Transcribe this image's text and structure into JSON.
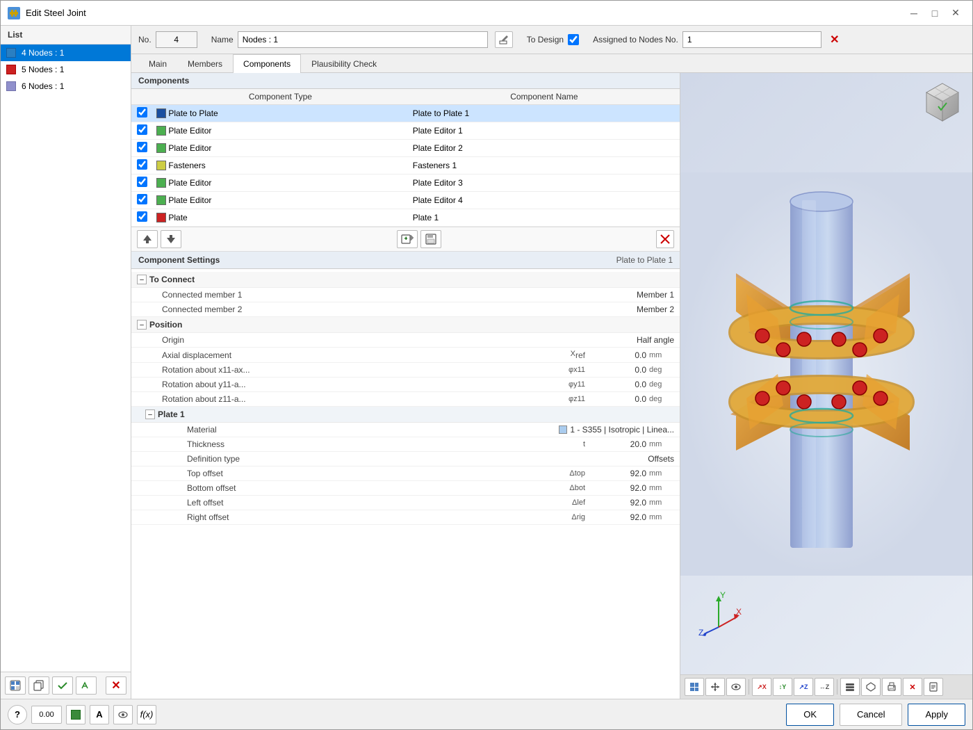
{
  "window": {
    "title": "Edit Steel Joint",
    "icon": "🔩"
  },
  "list": {
    "header": "List",
    "items": [
      {
        "id": 1,
        "label": "4  Nodes : 1",
        "color": "#2a7fc2",
        "selected": true
      },
      {
        "id": 2,
        "label": "5  Nodes : 1",
        "color": "#cc2222",
        "selected": false
      },
      {
        "id": 3,
        "label": "6  Nodes : 1",
        "color": "#9090cc",
        "selected": false
      }
    ]
  },
  "form": {
    "no_label": "No.",
    "no_value": "4",
    "name_label": "Name",
    "name_value": "Nodes : 1",
    "to_design_label": "To Design",
    "assigned_label": "Assigned to Nodes No.",
    "assigned_value": "1"
  },
  "tabs": [
    {
      "id": "main",
      "label": "Main",
      "active": false
    },
    {
      "id": "members",
      "label": "Members",
      "active": false
    },
    {
      "id": "components",
      "label": "Components",
      "active": true
    },
    {
      "id": "plausibility",
      "label": "Plausibility Check",
      "active": false
    }
  ],
  "components_section": {
    "header": "Components",
    "table_headers": [
      "",
      "Component Type",
      "Component Name"
    ],
    "rows": [
      {
        "checked": true,
        "color": "#1a4fa0",
        "type": "Plate to Plate",
        "name": "Plate to Plate 1",
        "selected": true
      },
      {
        "checked": true,
        "color": "#4caf50",
        "type": "Plate Editor",
        "name": "Plate Editor 1",
        "selected": false
      },
      {
        "checked": true,
        "color": "#4caf50",
        "type": "Plate Editor",
        "name": "Plate Editor 2",
        "selected": false
      },
      {
        "checked": true,
        "color": "#cdcd44",
        "type": "Fasteners",
        "name": "Fasteners 1",
        "selected": false
      },
      {
        "checked": true,
        "color": "#4caf50",
        "type": "Plate Editor",
        "name": "Plate Editor 3",
        "selected": false
      },
      {
        "checked": true,
        "color": "#4caf50",
        "type": "Plate Editor",
        "name": "Plate Editor 4",
        "selected": false
      },
      {
        "checked": true,
        "color": "#cc2222",
        "type": "Plate",
        "name": "Plate 1",
        "selected": false
      }
    ]
  },
  "comp_settings": {
    "header_title": "Component Settings",
    "header_name": "Plate to Plate 1",
    "groups": [
      {
        "id": "to_connect",
        "label": "To Connect",
        "collapsed": false,
        "rows": [
          {
            "label": "Connected member 1",
            "param": "",
            "value": "Member 1",
            "unit": "",
            "is_text": true
          },
          {
            "label": "Connected member 2",
            "param": "",
            "value": "Member 2",
            "unit": "",
            "is_text": true
          }
        ]
      },
      {
        "id": "position",
        "label": "Position",
        "collapsed": false,
        "rows": [
          {
            "label": "Origin",
            "param": "",
            "value": "Half angle",
            "unit": "",
            "is_text": true
          },
          {
            "label": "Axial displacement",
            "param": "Xref",
            "value": "0.0",
            "unit": "mm"
          },
          {
            "label": "Rotation about x11-ax...",
            "param": "φx11",
            "value": "0.0",
            "unit": "deg"
          },
          {
            "label": "Rotation about y11-a...",
            "param": "φy11",
            "value": "0.0",
            "unit": "deg"
          },
          {
            "label": "Rotation about z11-a...",
            "param": "φz11",
            "value": "0.0",
            "unit": "deg"
          }
        ]
      },
      {
        "id": "plate1",
        "label": "Plate 1",
        "collapsed": false,
        "rows": [
          {
            "label": "Material",
            "param": "",
            "value": "1 - S355 | Isotropic | Linea...",
            "unit": "",
            "is_text": true,
            "has_color": true,
            "color_val": "#aaccee"
          },
          {
            "label": "Thickness",
            "param": "t",
            "value": "20.0",
            "unit": "mm"
          },
          {
            "label": "Definition type",
            "param": "",
            "value": "Offsets",
            "unit": "",
            "is_text": true
          },
          {
            "label": "Top offset",
            "param": "Δtop",
            "value": "92.0",
            "unit": "mm"
          },
          {
            "label": "Bottom offset",
            "param": "Δbot",
            "value": "92.0",
            "unit": "mm"
          },
          {
            "label": "Left offset",
            "param": "Δlef",
            "value": "92.0",
            "unit": "mm"
          },
          {
            "label": "Right offset",
            "param": "Δrig",
            "value": "92.0",
            "unit": "mm"
          }
        ]
      }
    ]
  },
  "view_toolbar": {
    "buttons": [
      "⊞",
      "↕",
      "👁",
      "↗",
      "↕",
      "↔",
      "↕Z",
      "↔Z",
      "📋",
      "📦",
      "🖨",
      "✕",
      "📄"
    ]
  },
  "bottom_toolbar": {
    "left_buttons": [
      "?",
      "0.00",
      "🟩",
      "A",
      "👁",
      "f(x)"
    ]
  },
  "buttons": {
    "ok": "OK",
    "cancel": "Cancel",
    "apply": "Apply"
  }
}
